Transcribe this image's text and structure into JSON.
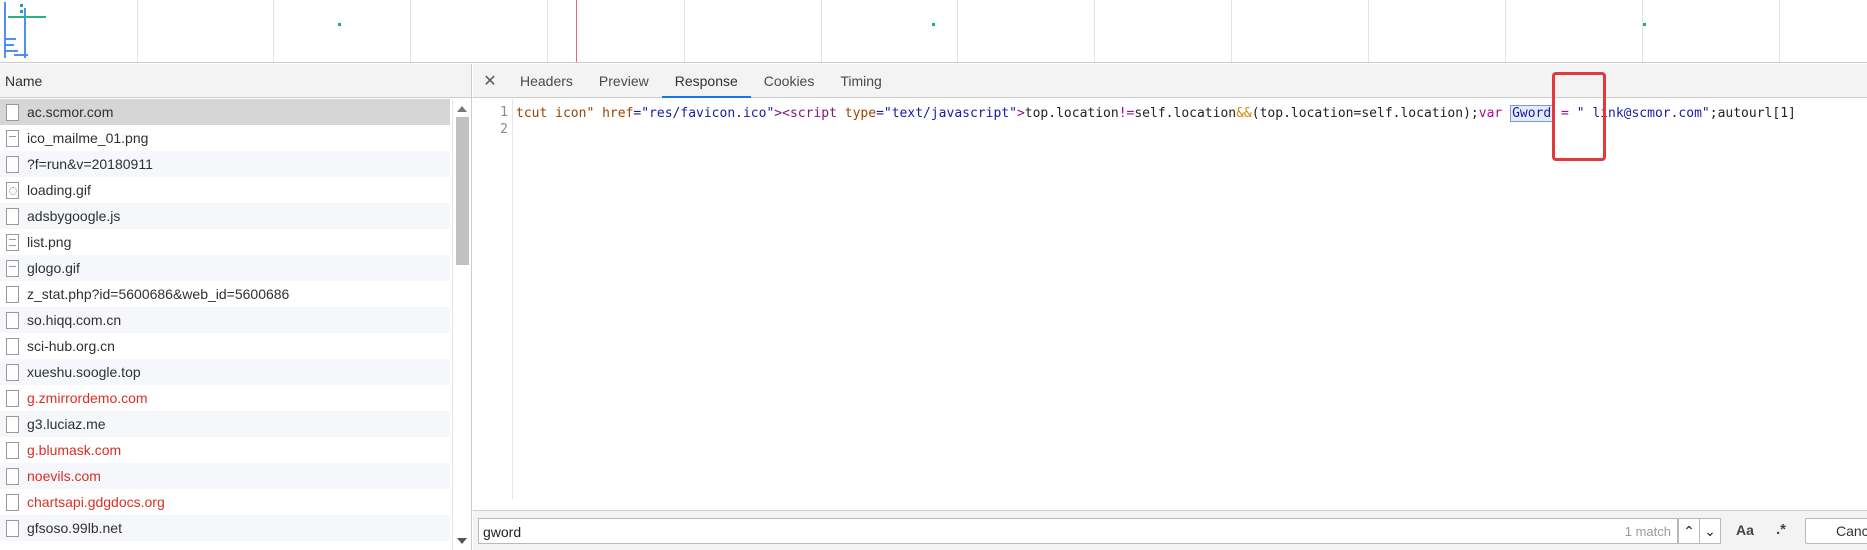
{
  "left_panel": {
    "header": "Name",
    "rows": [
      {
        "label": "ac.scmor.com",
        "icon": "file-icon",
        "error": false
      },
      {
        "label": "ico_mailme_01.png",
        "icon": "image-file-icon",
        "error": false
      },
      {
        "label": "?f=run&v=20180911",
        "icon": "file-icon",
        "error": false
      },
      {
        "label": "loading.gif",
        "icon": "gif-file-icon",
        "error": false
      },
      {
        "label": "adsbygoogle.js",
        "icon": "file-icon",
        "error": false
      },
      {
        "label": "list.png",
        "icon": "document-file-icon",
        "error": false
      },
      {
        "label": "glogo.gif",
        "icon": "image-file-icon",
        "error": false
      },
      {
        "label": "z_stat.php?id=5600686&web_id=5600686",
        "icon": "file-icon",
        "error": false
      },
      {
        "label": "so.hiqq.com.cn",
        "icon": "file-icon",
        "error": false
      },
      {
        "label": "sci-hub.org.cn",
        "icon": "file-icon",
        "error": false
      },
      {
        "label": "xueshu.soogle.top",
        "icon": "file-icon",
        "error": false
      },
      {
        "label": "g.zmirrordemo.com",
        "icon": "file-icon",
        "error": true
      },
      {
        "label": "g3.luciaz.me",
        "icon": "file-icon",
        "error": false
      },
      {
        "label": "g.blumask.com",
        "icon": "file-icon",
        "error": true
      },
      {
        "label": "noevils.com",
        "icon": "file-icon",
        "error": true
      },
      {
        "label": "chartsapi.gdgdocs.org",
        "icon": "file-icon",
        "error": true
      },
      {
        "label": "gfsoso.99lb.net",
        "icon": "file-icon",
        "error": false
      }
    ]
  },
  "detail_panel": {
    "close_glyph": "✕",
    "tabs": [
      {
        "label": "Headers",
        "active": false
      },
      {
        "label": "Preview",
        "active": false
      },
      {
        "label": "Response",
        "active": true
      },
      {
        "label": "Cookies",
        "active": false
      },
      {
        "label": "Timing",
        "active": false
      }
    ],
    "line_numbers": [
      "1",
      "2"
    ],
    "code": {
      "p1": "tcut icon\" ",
      "href_attr": "href",
      "href_val": "=\"res/favicon.ico\"",
      "gt": ">",
      "script_open": "<script ",
      "type_attr": "type",
      "type_val": "=\"text/javascript\"",
      "gt2": ">",
      "code1": "top.location",
      "neq": "!=",
      "code2": "self.location",
      "amp": "&&",
      "code3": "(top.location=self.location);",
      "var_kw": "var ",
      "match_word": "Gword",
      "eq": " = ",
      "str": "\" link@scmor.com\"",
      "tail": ";autourl[1]"
    }
  },
  "search": {
    "value": "gword",
    "match_count": "1 match",
    "up_glyph": "⌃",
    "down_glyph": "⌄",
    "case_label": "Aa",
    "regex_label": ".*",
    "cancel_label": "Cancel"
  },
  "colors": {
    "active_tab_underline": "#1a73e8",
    "error_text": "#d93025",
    "highlight_box": "#e23a3a"
  }
}
